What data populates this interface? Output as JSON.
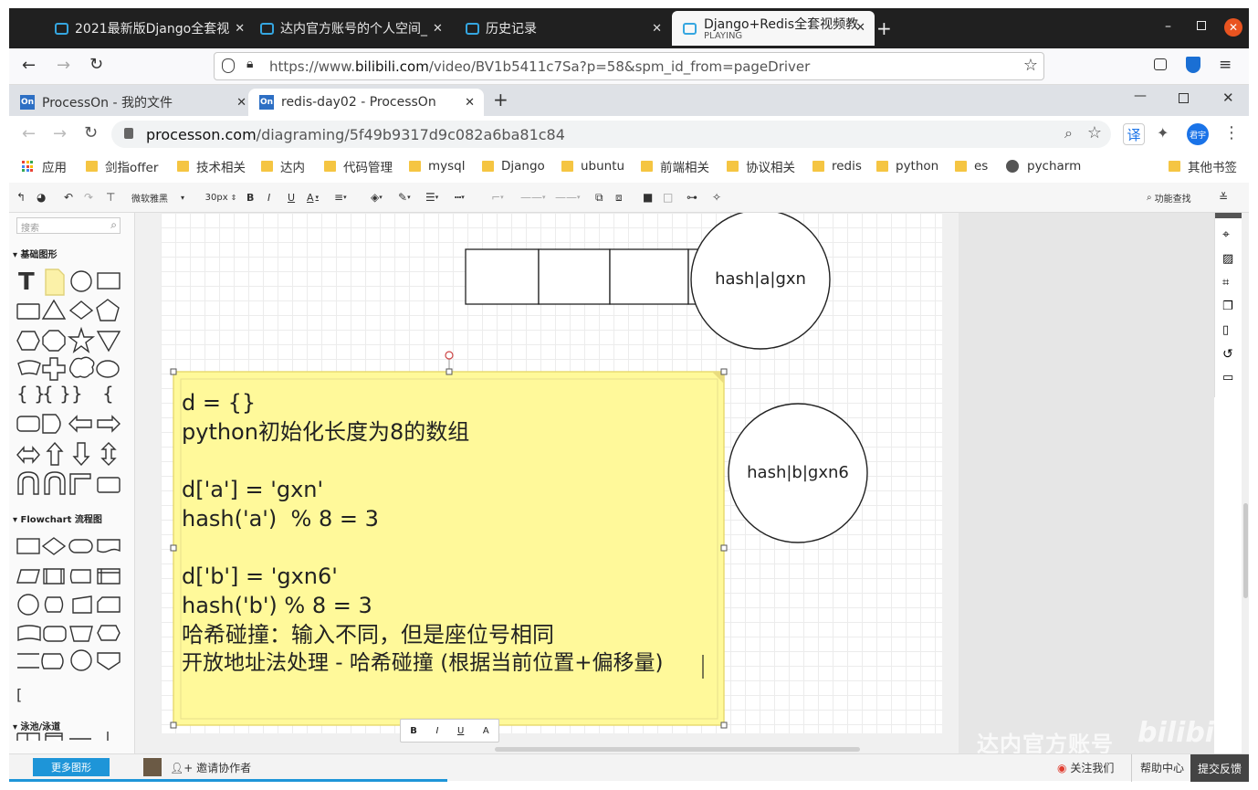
{
  "outer_browser": {
    "tabs": [
      {
        "label": "2021最新版Django全套视"
      },
      {
        "label": "达内官方账号的个人空间_"
      },
      {
        "label": "历史记录"
      },
      {
        "label": "Django+Redis全套视频教",
        "sublabel": "PLAYING",
        "active": true
      }
    ],
    "url_prefix": "https://www.",
    "url_domain": "bilibili.com",
    "url_rest": "/video/BV1b5411c7Sa?p=58&spm_id_from=pageDriver"
  },
  "inner_browser": {
    "tabs": [
      {
        "label": "ProcessOn - 我的文件"
      },
      {
        "label": "redis-day02 - ProcessOn",
        "active": true
      }
    ],
    "url_domain": "processon.com",
    "url_rest": "/diagraming/5f49b9317d9c082a6ba81c84",
    "translate_label": "译",
    "avatar_label": "君宇",
    "bookmarks": [
      "应用",
      "剑指offer",
      "技术相关",
      "达内",
      "代码管理",
      "mysql",
      "Django",
      "ubuntu",
      "前端相关",
      "协议相关",
      "redis",
      "python",
      "es",
      "pycharm"
    ],
    "other_bookmarks": "其他书签"
  },
  "toolbar": {
    "font_name": "微软雅黑",
    "font_size": "30px",
    "bold": "B",
    "italic": "I",
    "underline": "U",
    "font_color": "A",
    "feature_search": "功能查找"
  },
  "left_panel": {
    "search_placeholder": "搜索",
    "section_basic": "基础图形",
    "section_flowchart": "Flowchart 流程图",
    "section_swimlane": "泳池/泳道",
    "more_shapes": "更多图形"
  },
  "canvas": {
    "circle_a": "hash|a|gxn",
    "circle_b": "hash|b|gxn6",
    "note_lines": [
      "d = {}",
      "python初始化长度为8的数组",
      "",
      "d['a'] = 'gxn'",
      "hash('a')  % 8 = 3",
      "",
      "d['b'] = 'gxn6'",
      "hash('b') % 8 = 3",
      "哈希碰撞：输入不同，但是座位号相同",
      "开放地址法处理 - 哈希碰撞 (根据当前位置+偏移量)"
    ],
    "mini_toolbar": [
      "B",
      "I",
      "U",
      "A"
    ],
    "watermark": "达内官方账号"
  },
  "status_bar": {
    "invite": "邀请协作者",
    "follow": "关注我们",
    "help": "帮助中心",
    "feedback": "提交反馈"
  }
}
